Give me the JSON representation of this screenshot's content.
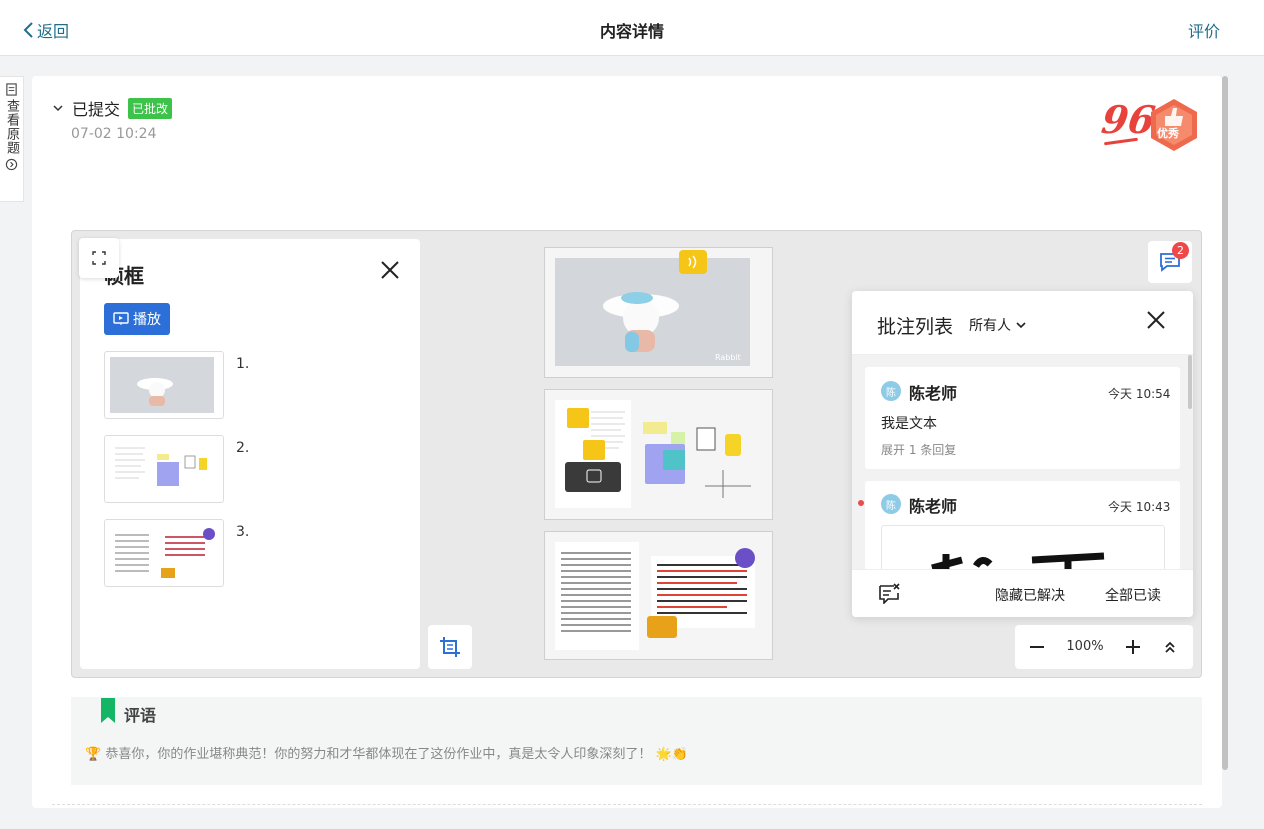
{
  "header": {
    "back_label": "返回",
    "title": "内容详情",
    "rate_label": "评价"
  },
  "side_tab": {
    "label": "查看原题"
  },
  "submission": {
    "status": "已提交",
    "badge": "已批改",
    "time": "07-02 10:24",
    "score": "96",
    "grade": "优秀"
  },
  "frame_panel": {
    "title": "帧框",
    "play_label": "播放",
    "items": [
      {
        "num": "1."
      },
      {
        "num": "2."
      },
      {
        "num": "3."
      }
    ]
  },
  "comments_toggle": {
    "count": "2"
  },
  "annotations": {
    "title": "批注列表",
    "filter": "所有人",
    "items": [
      {
        "avatar": "陈",
        "author": "陈老师",
        "time": "今天 10:54",
        "text": "我是文本",
        "replies": "展开 1 条回复"
      },
      {
        "avatar": "陈",
        "author": "陈老师",
        "time": "今天 10:43"
      }
    ],
    "hide_resolved": "隐藏已解决",
    "mark_all_read": "全部已读"
  },
  "zoom": {
    "value": "100%"
  },
  "review": {
    "heading": "评语",
    "text": "🏆 恭喜你，你的作业堪称典范！你的努力和才华都体现在了这份作业中，真是太令人印象深刻了！ 🌟👏"
  },
  "colors": {
    "accent": "#1f6f8b",
    "primary": "#2d6fd8",
    "success": "#3ec34a",
    "score": "#e8423c",
    "unread": "#e84c4c",
    "bookmark": "#15b566"
  }
}
